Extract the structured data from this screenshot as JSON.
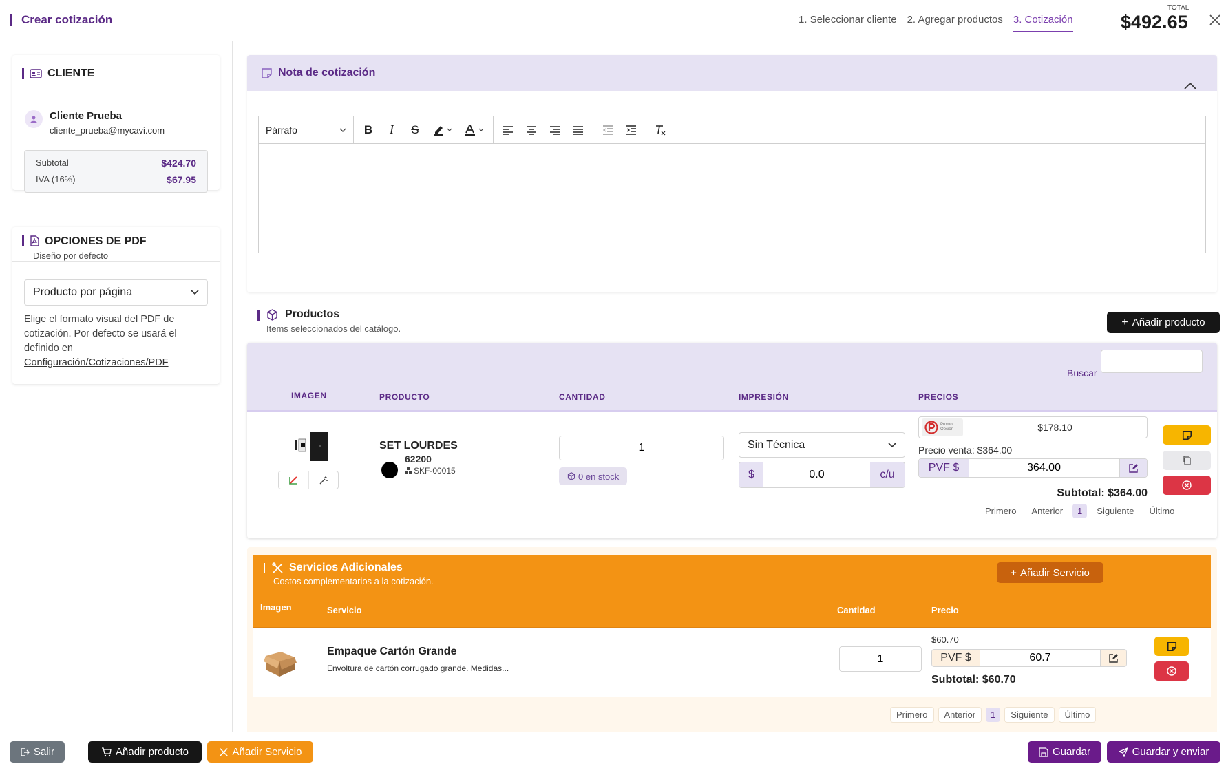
{
  "header": {
    "title": "Crear cotización",
    "steps": [
      "1. Seleccionar cliente",
      "2. Agregar productos",
      "3. Cotización"
    ],
    "active_step": 2,
    "total_label": "TOTAL",
    "total_value": "$492.65"
  },
  "client": {
    "section_title": "CLIENTE",
    "name": "Cliente Prueba",
    "email": "cliente_prueba@mycavi.com",
    "subtotal_label": "Subtotal",
    "subtotal_value": "$424.70",
    "iva_label": "IVA (16%)",
    "iva_value": "$67.95"
  },
  "pdf_options": {
    "section_title": "OPCIONES DE PDF",
    "subtitle": "Diseño por defecto",
    "selected": "Producto por página",
    "help_text": "Elige el formato visual del PDF de cotización. Por defecto se usará el definido en",
    "link": "Configuración/Cotizaciones/PDF"
  },
  "nota": {
    "title": "Nota de cotización",
    "format_select": "Párrafo"
  },
  "productos": {
    "title": "Productos",
    "subtitle": "Items seleccionados del catálogo.",
    "add_button": "Añadir producto",
    "search_label": "Buscar",
    "search_value": "",
    "columns": [
      "IMAGEN",
      "PRODUCTO",
      "CANTIDAD",
      "IMPRESIÓN",
      "PRECIOS"
    ],
    "row": {
      "name": "SET LOURDES",
      "code": "62200",
      "sku": "SKF-00015",
      "quantity": "1",
      "stock": "0 en stock",
      "impresion": "Sin Técnica",
      "imp_prefix": "$",
      "imp_value": "0.0",
      "imp_suffix": "c/u",
      "supplier_price": "$178.10",
      "supplier_logo_text": "Promo Opción",
      "precio_venta": "Precio venta: $364.00",
      "pvf_label": "PVF $",
      "pvf_value": "364.00",
      "subtotal": "Subtotal: $364.00"
    },
    "pager": {
      "first": "Primero",
      "prev": "Anterior",
      "page": "1",
      "next": "Siguiente",
      "last": "Último"
    }
  },
  "servicios": {
    "title": "Servicios Adicionales",
    "subtitle": "Costos complementarios a la cotización.",
    "add_button": "Añadir Servicio",
    "columns": [
      "Imagen",
      "Servicio",
      "Cantidad",
      "Precio"
    ],
    "row": {
      "name": "Empaque Cartón Grande",
      "description": "Envoltura de cartón corrugado grande. Medidas...",
      "quantity": "1",
      "price": "$60.70",
      "pvf_label": "PVF $",
      "pvf_value": "60.7",
      "subtotal": "Subtotal: $60.70"
    },
    "pager": {
      "first": "Primero",
      "prev": "Anterior",
      "page": "1",
      "next": "Siguiente",
      "last": "Último"
    }
  },
  "footer": {
    "salir": "Salir",
    "add_product": "Añadir producto",
    "add_service": "Añadir Servicio",
    "guardar": "Guardar",
    "guardar_enviar": "Guardar y enviar"
  },
  "colors": {
    "brand": "#5b2a86",
    "accent_light": "#e6e2f3",
    "orange": "#f39314",
    "yellow": "#f7b500",
    "red": "#dc3545"
  }
}
